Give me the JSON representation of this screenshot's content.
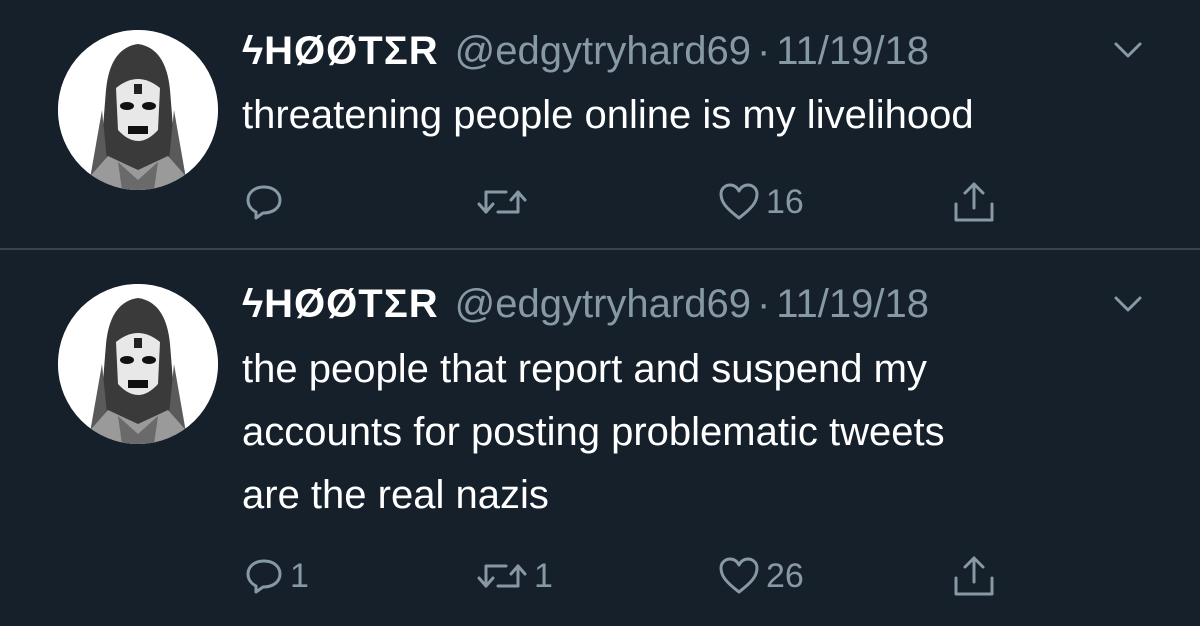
{
  "tweets": [
    {
      "display_name": "ϟHØØTΣR",
      "handle": "@edgytryhard69",
      "separator": "·",
      "date": "11/19/18",
      "text_lines": [
        "threatening people online is my livelihood"
      ],
      "reply_count": "",
      "retweet_count": "",
      "like_count": "16"
    },
    {
      "display_name": "ϟHØØTΣR",
      "handle": "@edgytryhard69",
      "separator": "·",
      "date": "11/19/18",
      "text_lines": [
        "the people that report and suspend my",
        "accounts for posting problematic tweets",
        "are the real nazis"
      ],
      "reply_count": "1",
      "retweet_count": "1",
      "like_count": "26"
    }
  ],
  "icons": {
    "reply": "reply-icon",
    "retweet": "retweet-icon",
    "like": "heart-icon",
    "share": "share-icon",
    "more": "chevron-down-icon",
    "avatar": "avatar-image"
  },
  "colors": {
    "background": "#15202b",
    "primary_text": "#ffffff",
    "secondary_text": "#8899a6",
    "divider": "#38444d"
  }
}
